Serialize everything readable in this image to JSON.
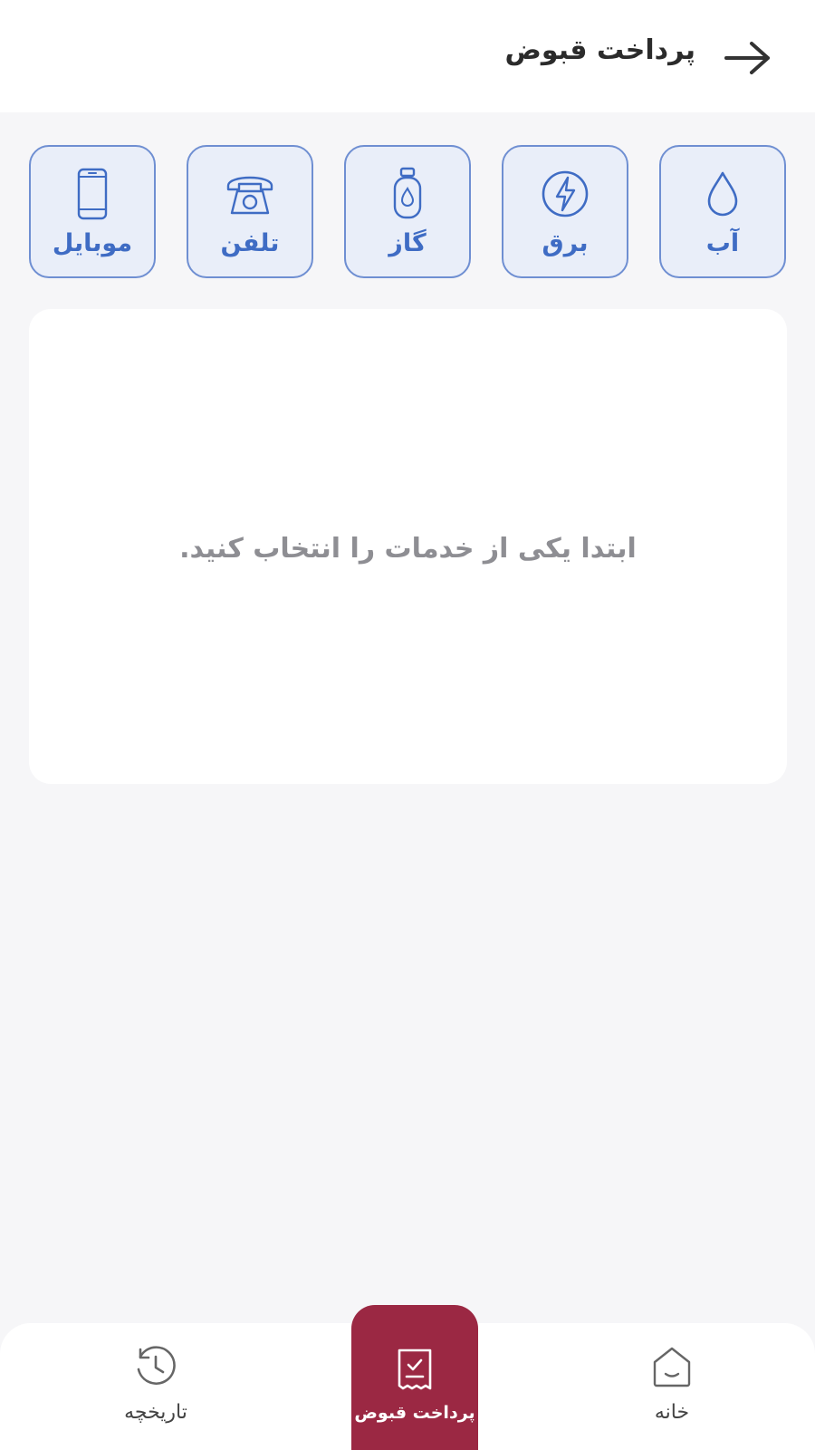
{
  "header": {
    "title": "پرداخت قبوض",
    "back_icon": "arrow-right-icon"
  },
  "services": [
    {
      "label": "آب",
      "icon": "water-drop-icon"
    },
    {
      "label": "برق",
      "icon": "lightning-icon"
    },
    {
      "label": "گاز",
      "icon": "gas-cylinder-icon"
    },
    {
      "label": "تلفن",
      "icon": "telephone-icon"
    },
    {
      "label": "موبایل",
      "icon": "mobile-phone-icon"
    }
  ],
  "content": {
    "empty_message": "ابتدا یکی از خدمات را انتخاب کنید."
  },
  "bottom_nav": {
    "home": {
      "label": "خانه",
      "icon": "home-icon"
    },
    "bills": {
      "label": "پرداخت قبوض",
      "icon": "receipt-check-icon",
      "active": true
    },
    "history": {
      "label": "تاریخچه",
      "icon": "history-clock-icon"
    }
  },
  "colors": {
    "accent_blue": "#3f6cc4",
    "tile_bg": "#e9eef9",
    "tile_border": "#6f8fd2",
    "nav_active_bg": "#9b2843"
  }
}
